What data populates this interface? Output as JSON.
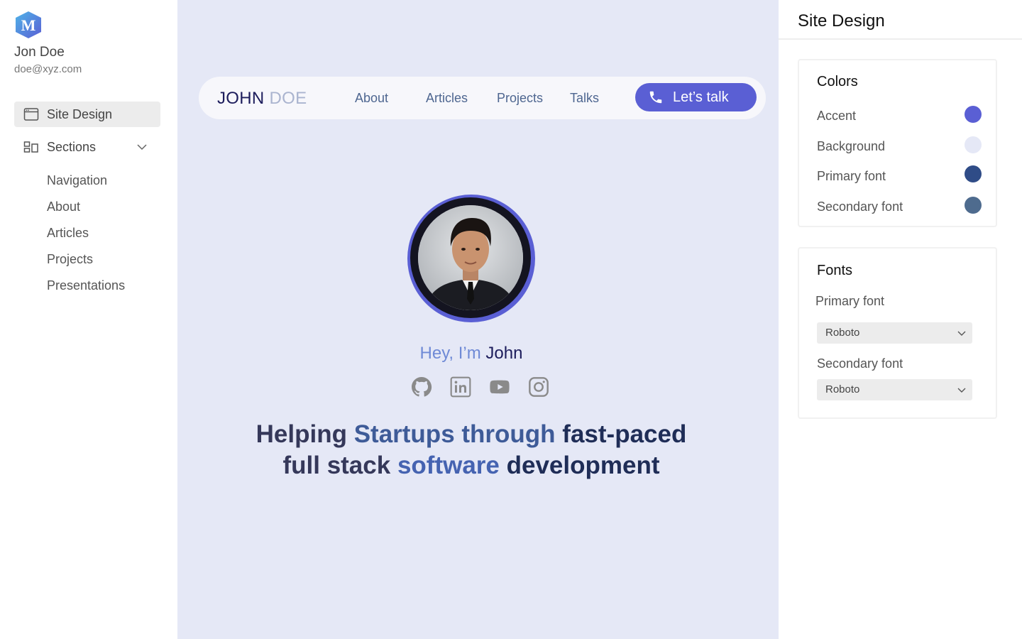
{
  "sidebar": {
    "logo_letter": "M",
    "user_name": "Jon Doe",
    "user_email": "doe@xyz.com",
    "site_design_label": "Site Design",
    "sections_label": "Sections",
    "section_items": [
      "Navigation",
      "About",
      "Articles",
      "Projects",
      "Presentations"
    ]
  },
  "preview": {
    "brand_first": "JOHN",
    "brand_last": "DOE",
    "nav_links": [
      "About",
      "Articles",
      "Projects",
      "Talks"
    ],
    "cta_label": "Let’s talk",
    "greeting_prefix": "Hey, I’m",
    "greeting_name": "John",
    "social_icons": [
      "github-icon",
      "linkedin-icon",
      "youtube-icon",
      "instagram-icon"
    ],
    "headline": {
      "w1": "Helping",
      "w2": "Startups through",
      "w3": "fast-paced",
      "w4": "full stack",
      "w5": "software",
      "w6": "development"
    }
  },
  "panel": {
    "title": "Site Design",
    "colors_title": "Colors",
    "colors": [
      {
        "label": "Accent",
        "color": "#5a5fd4"
      },
      {
        "label": "Background",
        "color": "#e5e8f6"
      },
      {
        "label": "Primary font",
        "color": "#2f4c87"
      },
      {
        "label": "Secondary font",
        "color": "#4e6b8e"
      }
    ],
    "fonts_title": "Fonts",
    "primary_font_label": "Primary font",
    "primary_font_value": "Roboto",
    "secondary_font_label": "Secondary font",
    "secondary_font_value": "Roboto"
  }
}
